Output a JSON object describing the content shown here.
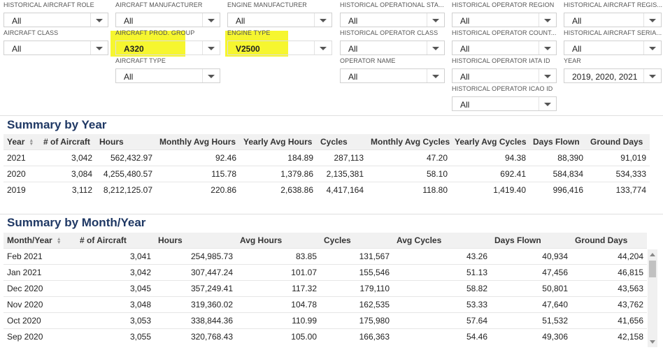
{
  "filters": {
    "historical_aircraft_role": {
      "label": "HISTORICAL AIRCRAFT ROLE",
      "value": "All"
    },
    "aircraft_manufacturer": {
      "label": "AIRCRAFT MANUFACTURER",
      "value": "All"
    },
    "engine_manufacturer": {
      "label": "ENGINE MANUFACTURER",
      "value": "All"
    },
    "historical_operational_status": {
      "label": "HISTORICAL OPERATIONAL STA...",
      "value": "All"
    },
    "historical_operator_region": {
      "label": "HISTORICAL OPERATOR REGION",
      "value": "All"
    },
    "historical_aircraft_registration": {
      "label": "HISTORICAL AIRCRAFT REGIS...",
      "value": "All"
    },
    "aircraft_class": {
      "label": "AIRCRAFT CLASS",
      "value": "All"
    },
    "aircraft_prod_group": {
      "label": "AIRCRAFT PROD. GROUP",
      "value": "A320"
    },
    "engine_type": {
      "label": "ENGINE TYPE",
      "value": "V2500"
    },
    "historical_operator_class": {
      "label": "HISTORICAL OPERATOR CLASS",
      "value": "All"
    },
    "historical_operator_country": {
      "label": "HISTORICAL OPERATOR COUNT...",
      "value": "All"
    },
    "historical_aircraft_serial": {
      "label": "HISTORICAL AIRCRAFT SERIA...",
      "value": "All"
    },
    "aircraft_type": {
      "label": "AIRCRAFT TYPE",
      "value": "All"
    },
    "operator_name": {
      "label": "OPERATOR NAME",
      "value": "All"
    },
    "historical_operator_iata": {
      "label": "HISTORICAL OPERATOR IATA ID",
      "value": "All"
    },
    "year": {
      "label": "YEAR",
      "value": "2019, 2020, 2021"
    },
    "historical_operator_icao": {
      "label": "HISTORICAL OPERATOR ICAO ID",
      "value": "All"
    }
  },
  "highlight_color": "#f4f40a",
  "title_color": "#1f3864",
  "summary_year": {
    "title": "Summary by Year",
    "columns": [
      "Year",
      "# of Aircraft",
      "Hours",
      "Monthly Avg Hours",
      "Yearly Avg Hours",
      "Cycles",
      "Monthly Avg Cycles",
      "Yearly Avg Cycles",
      "Days Flown",
      "Ground Days"
    ],
    "rows": [
      [
        "2021",
        "3,042",
        "562,432.97",
        "92.46",
        "184.89",
        "287,113",
        "47.20",
        "94.38",
        "88,390",
        "91,019"
      ],
      [
        "2020",
        "3,084",
        "4,255,480.57",
        "115.78",
        "1,379.86",
        "2,135,381",
        "58.10",
        "692.41",
        "584,834",
        "534,333"
      ],
      [
        "2019",
        "3,112",
        "8,212,125.07",
        "220.86",
        "2,638.86",
        "4,417,164",
        "118.80",
        "1,419.40",
        "996,416",
        "133,774"
      ]
    ]
  },
  "summary_month": {
    "title": "Summary by Month/Year",
    "columns": [
      "Month/Year",
      "# of Aircraft",
      "Hours",
      "Avg Hours",
      "Cycles",
      "Avg Cycles",
      "Days Flown",
      "Ground Days"
    ],
    "rows": [
      [
        "Feb 2021",
        "3,041",
        "254,985.73",
        "83.85",
        "131,567",
        "43.26",
        "40,934",
        "44,204"
      ],
      [
        "Jan 2021",
        "3,042",
        "307,447.24",
        "101.07",
        "155,546",
        "51.13",
        "47,456",
        "46,815"
      ],
      [
        "Dec 2020",
        "3,045",
        "357,249.41",
        "117.32",
        "179,110",
        "58.82",
        "50,801",
        "43,563"
      ],
      [
        "Nov 2020",
        "3,048",
        "319,360.02",
        "104.78",
        "162,535",
        "53.33",
        "47,640",
        "43,762"
      ],
      [
        "Oct 2020",
        "3,053",
        "338,844.36",
        "110.99",
        "175,980",
        "57.64",
        "51,532",
        "41,656"
      ],
      [
        "Sep 2020",
        "3,055",
        "320,768.43",
        "105.00",
        "166,363",
        "54.46",
        "49,306",
        "42,158"
      ]
    ]
  }
}
